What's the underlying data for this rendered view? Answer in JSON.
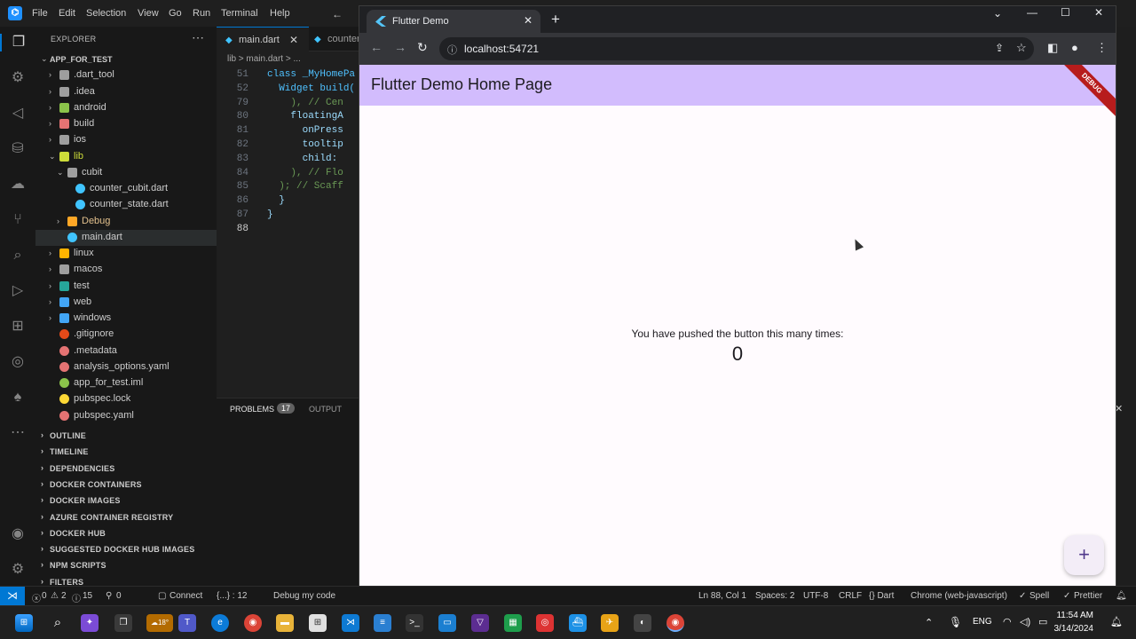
{
  "vscode": {
    "menu": [
      "File",
      "Edit",
      "Selection",
      "View",
      "Go",
      "Run",
      "Terminal",
      "Help"
    ],
    "explorer_title": "EXPLORER",
    "tabs": [
      "main.dart",
      "counter"
    ],
    "breadcrumb": "lib > main.dart > ...",
    "tree": [
      {
        "label": "APP_FOR_TEST",
        "kind": "root"
      },
      {
        "label": ".dart_tool",
        "kind": "folder",
        "color": "#9e9e9e"
      },
      {
        "label": ".idea",
        "kind": "folder",
        "color": "#9e9e9e"
      },
      {
        "label": "android",
        "kind": "folder",
        "color": "#8bc34a"
      },
      {
        "label": "build",
        "kind": "folder",
        "color": "#e57373"
      },
      {
        "label": "ios",
        "kind": "folder",
        "color": "#9e9e9e"
      },
      {
        "label": "lib",
        "kind": "folder-open",
        "color": "#cddc39"
      },
      {
        "label": "cubit",
        "kind": "folder-open",
        "color": "#9e9e9e"
      },
      {
        "label": "counter_cubit.dart",
        "kind": "file",
        "color": "#40c4ff"
      },
      {
        "label": "counter_state.dart",
        "kind": "file",
        "color": "#40c4ff"
      },
      {
        "label": "Debug",
        "kind": "folder",
        "color": "#ffa726"
      },
      {
        "label": "main.dart",
        "kind": "file",
        "color": "#40c4ff"
      },
      {
        "label": "linux",
        "kind": "folder",
        "color": "#ffb300"
      },
      {
        "label": "macos",
        "kind": "folder",
        "color": "#9e9e9e"
      },
      {
        "label": "test",
        "kind": "folder",
        "color": "#26a69a"
      },
      {
        "label": "web",
        "kind": "folder",
        "color": "#42a5f5"
      },
      {
        "label": "windows",
        "kind": "folder",
        "color": "#42a5f5"
      },
      {
        "label": ".gitignore",
        "kind": "file",
        "color": "#e64a19"
      },
      {
        "label": ".metadata",
        "kind": "file",
        "color": "#e57373"
      },
      {
        "label": "analysis_options.yaml",
        "kind": "file",
        "color": "#e57373"
      },
      {
        "label": "app_for_test.iml",
        "kind": "file",
        "color": "#8bc34a"
      },
      {
        "label": "pubspec.lock",
        "kind": "file",
        "color": "#fdd835"
      },
      {
        "label": "pubspec.yaml",
        "kind": "file",
        "color": "#e57373"
      }
    ],
    "sections": [
      "OUTLINE",
      "TIMELINE",
      "DEPENDENCIES",
      "DOCKER CONTAINERS",
      "DOCKER IMAGES",
      "AZURE CONTAINER REGISTRY",
      "DOCKER HUB",
      "SUGGESTED DOCKER HUB IMAGES",
      "NPM SCRIPTS",
      "FILTERS"
    ],
    "code_lines": [
      {
        "no": "51",
        "text": "class _MyHomePa"
      },
      {
        "no": "52",
        "text": "  Widget build("
      },
      {
        "no": "79",
        "text": "    ), // Cen"
      },
      {
        "no": "80",
        "text": "    floatingA"
      },
      {
        "no": "81",
        "text": "      onPress"
      },
      {
        "no": "82",
        "text": "      tooltip"
      },
      {
        "no": "83",
        "text": "      child:"
      },
      {
        "no": "84",
        "text": "    ), // Flo"
      },
      {
        "no": "85",
        "text": "  ); // Scaff"
      },
      {
        "no": "86",
        "text": "  }"
      },
      {
        "no": "87",
        "text": "}"
      },
      {
        "no": "88",
        "text": ""
      }
    ],
    "panel": {
      "problems": "PROBLEMS",
      "problems_count": "17",
      "output": "OUTPUT"
    },
    "statusbar": {
      "errors": "0",
      "warnings": "2",
      "infos": "15",
      "ports": "0",
      "connect": "Connect",
      "selection": "{...} : 12",
      "debug": "Debug my code",
      "position": "Ln 88, Col 1",
      "spaces": "Spaces: 2",
      "encoding": "UTF-8",
      "eol": "CRLF",
      "language": "{} Dart",
      "device": "Chrome (web-javascript)",
      "spell": "Spell",
      "prettier": "Prettier"
    }
  },
  "browser": {
    "tab_title": "Flutter Demo",
    "url": "localhost:54721"
  },
  "app": {
    "title": "Flutter Demo Home Page",
    "debug_banner": "DEBUG",
    "counter_label": "You have pushed the button this many times:",
    "counter_value": "0",
    "fab_icon": "+"
  },
  "taskbar": {
    "temp": "18°",
    "lang": "ENG",
    "time": "11:54 AM",
    "date": "3/14/2024"
  }
}
